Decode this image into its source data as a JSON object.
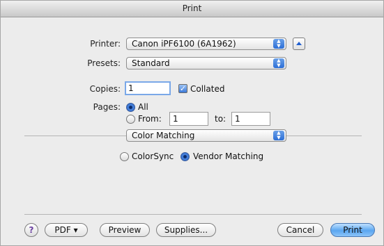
{
  "window": {
    "title": "Print"
  },
  "printer": {
    "label": "Printer:",
    "value": "Canon iPF6100 (6A1962)"
  },
  "presets": {
    "label": "Presets:",
    "value": "Standard"
  },
  "copies": {
    "label": "Copies:",
    "value": "1",
    "collated_label": "Collated",
    "collated": true
  },
  "pages": {
    "label": "Pages:",
    "all_label": "All",
    "from_label": "From:",
    "from_value": "1",
    "to_label": "to:",
    "to_value": "1",
    "selected": "All"
  },
  "panel_menu": {
    "value": "Color Matching"
  },
  "color_matching": {
    "colorsync_label": "ColorSync",
    "vendor_label": "Vendor Matching",
    "selected": "Vendor Matching"
  },
  "buttons": {
    "help": "?",
    "pdf": "PDF ▾",
    "preview": "Preview",
    "supplies": "Supplies...",
    "cancel": "Cancel",
    "print": "Print"
  },
  "icons": {
    "popup_arrows": "up-down-arrows-icon",
    "disclosure": "disclosure-triangle-icon",
    "help": "question-mark-icon"
  },
  "colors": {
    "accent": "#3c79d8",
    "default_button": "#5aa6f0"
  }
}
